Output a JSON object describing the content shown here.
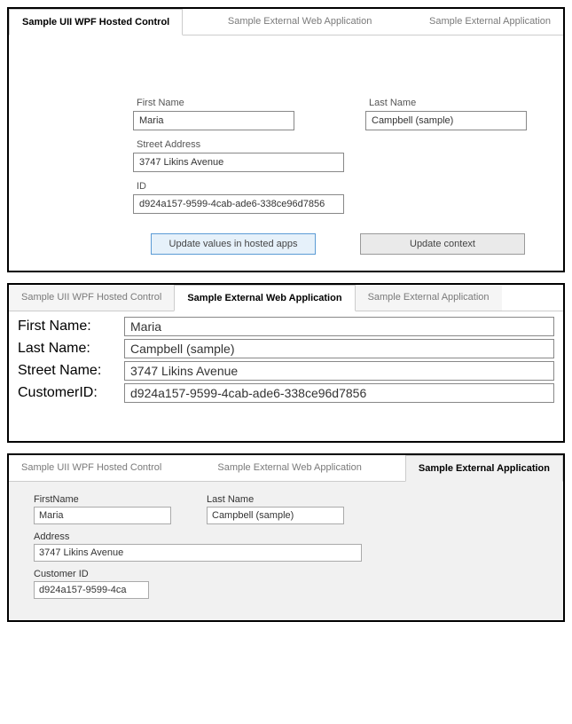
{
  "tabs": {
    "wpf": "Sample UII WPF Hosted Control",
    "web": "Sample External Web Application",
    "ext": "Sample External Application"
  },
  "panel1": {
    "labels": {
      "firstName": "First Name",
      "lastName": "Last Name",
      "street": "Street Address",
      "id": "ID"
    },
    "values": {
      "firstName": "Maria",
      "lastName": "Campbell (sample)",
      "street": "3747 Likins Avenue",
      "id": "d924a157-9599-4cab-ade6-338ce96d7856"
    },
    "buttons": {
      "update": "Update values in hosted apps",
      "context": "Update context"
    }
  },
  "panel2": {
    "labels": {
      "firstName": "First Name:",
      "lastName": "Last Name:",
      "streetName": "Street Name:",
      "customerId": "CustomerID:"
    },
    "values": {
      "firstName": "Maria",
      "lastName": "Campbell (sample)",
      "streetName": "3747 Likins Avenue",
      "customerId": "d924a157-9599-4cab-ade6-338ce96d7856"
    }
  },
  "panel3": {
    "labels": {
      "firstName": "FirstName",
      "lastName": "Last Name",
      "address": "Address",
      "customerId": "Customer ID"
    },
    "values": {
      "firstName": "Maria",
      "lastName": "Campbell (sample)",
      "address": "3747 Likins Avenue",
      "customerId": "d924a157-9599-4ca"
    }
  }
}
